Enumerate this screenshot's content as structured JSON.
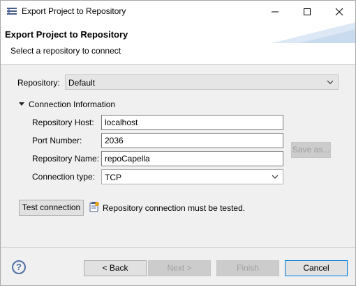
{
  "window": {
    "title": "Export Project to Repository",
    "minimize": "—",
    "maximize": "☐",
    "close": "✕"
  },
  "banner": {
    "title": "Export Project to Repository",
    "subtitle": "Select a repository to connect"
  },
  "repository": {
    "label": "Repository:",
    "value": "Default"
  },
  "connection": {
    "section_label": "Connection Information",
    "host_label": "Repository Host:",
    "host_value": "localhost",
    "port_label": "Port Number:",
    "port_value": "2036",
    "name_label": "Repository Name:",
    "name_value": "repoCapella",
    "type_label": "Connection type:",
    "type_value": "TCP",
    "save_as": "Save as..."
  },
  "test": {
    "button": "Test connection",
    "status": "Repository connection must be tested."
  },
  "footer": {
    "help": "?",
    "back": "< Back",
    "next": "Next >",
    "finish": "Finish",
    "cancel": "Cancel"
  },
  "colors": {
    "accent": "#0078d7",
    "banner_deco": "#dce8f5"
  }
}
